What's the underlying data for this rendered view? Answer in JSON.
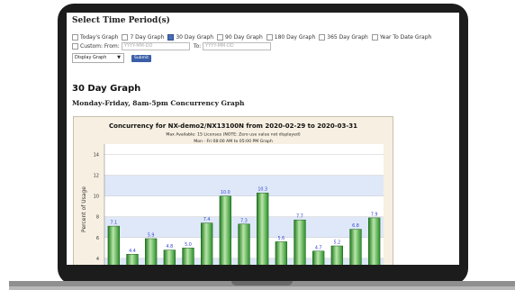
{
  "section_title": "Select Time Period(s)",
  "period_options": [
    {
      "label": "Today's Graph",
      "checked": false
    },
    {
      "label": "7 Day Graph",
      "checked": false
    },
    {
      "label": "30 Day Graph",
      "checked": true
    },
    {
      "label": "90 Day Graph",
      "checked": false
    },
    {
      "label": "180 Day Graph",
      "checked": false
    },
    {
      "label": "365 Day Graph",
      "checked": false
    },
    {
      "label": "Year To Date Graph",
      "checked": false
    }
  ],
  "custom": {
    "label": "Custom: From:",
    "from_placeholder": "YYYY-MM-DD",
    "to_label": "To:",
    "to_placeholder": "YYYY-MM-DD"
  },
  "display_select": {
    "value": "Display Graph",
    "caret": "▼"
  },
  "submit_label": "Submit",
  "graph_heading": "30 Day Graph",
  "graph_subheading": "Monday-Friday, 8am-5pm Concurrency Graph",
  "colors": {
    "bar": "#2f9a2f",
    "bar_highlight": "#b9e6a8",
    "band": "#dfe8f8",
    "label": "#2f3fd0",
    "lid": "#1c1c1c"
  },
  "chart_data": {
    "type": "bar",
    "title": "Concurrency for NX-demo2/NX13100N from 2020-02-29 to 2020-03-31",
    "subtitle_1": "Max Available: 15 Licenses (NOTE: Zero use value not displayed)",
    "subtitle_2": "Mon - Fri 08:00 AM to 05:00 PM Graph",
    "ylabel": "Percent of Usage",
    "yticks": [
      2,
      4,
      6,
      8,
      10,
      12,
      14
    ],
    "ylim": [
      0,
      15
    ],
    "values": [
      7.1,
      4.4,
      5.9,
      4.8,
      5.0,
      7.4,
      10.0,
      7.3,
      10.3,
      5.6,
      7.7,
      4.7,
      5.2,
      6.8,
      7.9
    ],
    "grid": true
  }
}
